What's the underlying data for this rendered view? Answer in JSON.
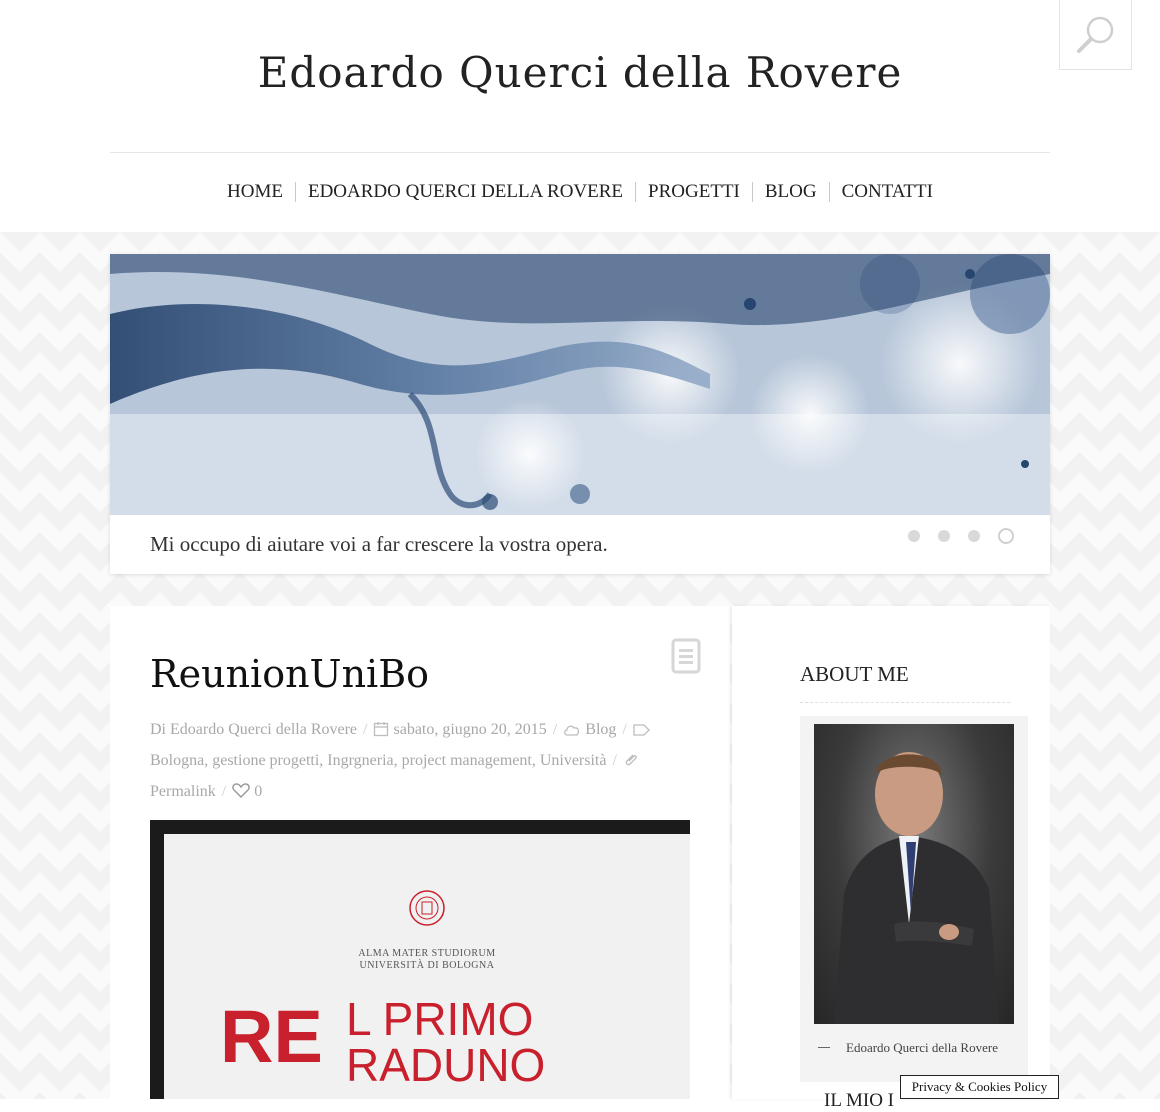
{
  "site": {
    "title": "Edoardo Querci della Rovere"
  },
  "nav": {
    "items": [
      "HOME",
      "EDOARDO QUERCI DELLA ROVERE",
      "PROGETTI",
      "BLOG",
      "CONTATTI"
    ]
  },
  "slider": {
    "caption": "Mi occupo di aiutare voi a far crescere la vostra opera.",
    "slide_count": 4,
    "active_slide": 4
  },
  "post": {
    "title": "ReunionUniBo",
    "author": "Di Edoardo Querci della Rovere",
    "date": "sabato, giugno 20, 2015",
    "category": "Blog",
    "tags": "Bologna, gestione progetti, Ingrgneria, project management, Università",
    "permalink": "Permalink",
    "likes": "0"
  },
  "poster": {
    "uni_line1": "ALMA MATER STUDIORUM",
    "uni_line2": "UNIVERSITÀ DI BOLOGNA",
    "big": "RE",
    "line1": "L PRIMO",
    "line2": "RADUNO"
  },
  "sidebar": {
    "title": "ABOUT ME",
    "photo_caption": "Edoardo Querci della Rovere",
    "next_heading": "IL MIO I"
  },
  "cookie": {
    "label": "Privacy & Cookies Policy"
  },
  "colors": {
    "accent_red": "#c8202c",
    "meta_gray": "#a8a8a8"
  }
}
